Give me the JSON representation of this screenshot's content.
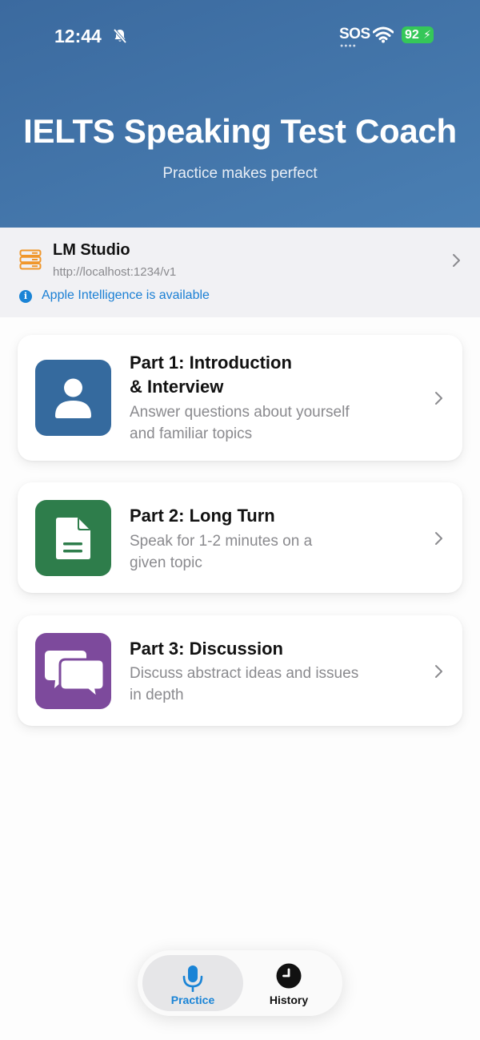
{
  "status_bar": {
    "time": "12:44",
    "carrier": "SOS",
    "battery": "92",
    "icons": [
      "bell-slash-icon",
      "wifi-icon",
      "battery-charging-icon"
    ]
  },
  "header": {
    "title": "IELTS Speaking Test Coach",
    "subtitle": "Practice makes perfect"
  },
  "server": {
    "name": "LM Studio",
    "url": "http://localhost:1234/v1",
    "notice": "Apple Intelligence is available",
    "icon": "server-icon",
    "accent": "#f0962a"
  },
  "parts": [
    {
      "title_line1": "Part 1: Introduction",
      "title_line2": "& Interview",
      "desc_line1": "Answer questions about yourself",
      "desc_line2": "and familiar topics",
      "icon": "person-icon",
      "color": "#356a9e"
    },
    {
      "title_line1": "Part 2: Long Turn",
      "desc_line1": "Speak for 1-2 minutes on a",
      "desc_line2": "given topic",
      "icon": "document-icon",
      "color": "#2e7d4b"
    },
    {
      "title_line1": "Part 3: Discussion",
      "desc_line1": "Discuss abstract ideas and issues",
      "desc_line2": "in depth",
      "icon": "chat-bubbles-icon",
      "color": "#7d4a9c"
    }
  ],
  "tabbar": {
    "practice_label": "Practice",
    "history_label": "History",
    "active_color": "#1a84d6"
  }
}
